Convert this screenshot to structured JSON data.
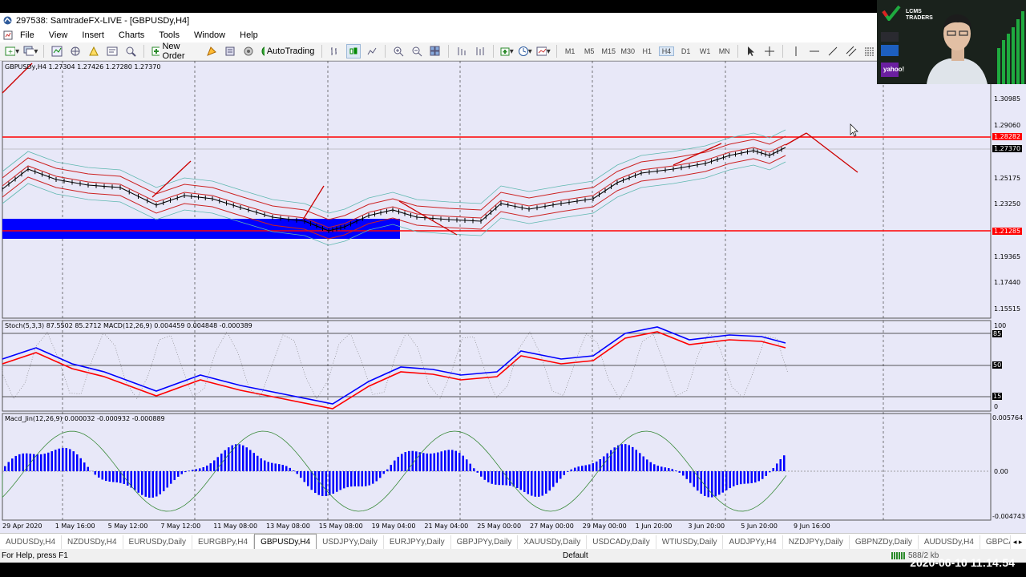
{
  "window": {
    "title": "297538: SamtradeFX-LIVE - [GBPUSDy,H4]"
  },
  "menu": [
    "File",
    "View",
    "Insert",
    "Charts",
    "Tools",
    "Window",
    "Help"
  ],
  "toolbar": {
    "new_order": "New Order",
    "autotrading": "AutoTrading",
    "timeframes": [
      "M1",
      "M5",
      "M15",
      "M30",
      "H1",
      "H4",
      "D1",
      "W1",
      "MN"
    ],
    "active_timeframe": "H4"
  },
  "main_pane": {
    "info": "GBPUSDy,H4  1.27304 1.27426 1.27280 1.27370",
    "price_labels": [
      "1.30985",
      "1.29060",
      "1.27370",
      "1.25175",
      "1.23250",
      "1.21285",
      "1.19365",
      "1.17440",
      "1.15515"
    ],
    "resistance_label": "1.28282",
    "support_label": "1.21285",
    "current_price_label": "1.27370"
  },
  "stoch_pane": {
    "info": "Stoch(5,3,3) 87.5502 85.2712  MACD(12,26,9) 0.004459 0.004848 -0.000389",
    "levels": [
      "100",
      "85",
      "50",
      "15",
      "0"
    ]
  },
  "macd_pane": {
    "info": "Macd_Jin(12,26,9) 0.000032 -0.000932 -0.000889",
    "levels": [
      "0.005764",
      "0.00",
      "-0.004743"
    ]
  },
  "time_labels": [
    "29 Apr 2020",
    "1 May 16:00",
    "5 May 12:00",
    "7 May 12:00",
    "11 May 08:00",
    "13 May 08:00",
    "15 May 08:00",
    "19 May 04:00",
    "21 May 04:00",
    "25 May 00:00",
    "27 May 00:00",
    "29 May 00:00",
    "1 Jun 20:00",
    "3 Jun 20:00",
    "5 Jun 20:00",
    "9 Jun 16:00"
  ],
  "tabs": [
    "AUDUSDy,H4",
    "NZDUSDy,H4",
    "EURUSDy,Daily",
    "EURGBPy,H4",
    "GBPUSDy,H4",
    "USDJPYy,Daily",
    "EURJPYy,Daily",
    "GBPJPYy,Daily",
    "XAUUSDy,Daily",
    "USDCADy,Daily",
    "WTIUSDy,Daily",
    "AUDJPYy,H4",
    "NZDJPYy,Daily",
    "GBPNZDy,Daily",
    "AUDUSDy,H4",
    "GBPCA"
  ],
  "active_tab": "GBPUSDy,H4",
  "status": {
    "help": "For Help, press F1",
    "profile": "Default",
    "traffic": "588/2 kb"
  },
  "timestamp": "2020-06-10 11:14:54",
  "webcam": {
    "brand_line1": "LCMS",
    "brand_line2": "TRADERS",
    "sponsor": "yahoo!"
  },
  "colors": {
    "resistance": "#ff0000",
    "support": "#ff0000",
    "zone": "#0000ff",
    "chart_bg": "#e8e8f8",
    "macd_hist": "#0000ff",
    "stoch_main": "#0000ff",
    "stoch_signal": "#ff0000"
  }
}
